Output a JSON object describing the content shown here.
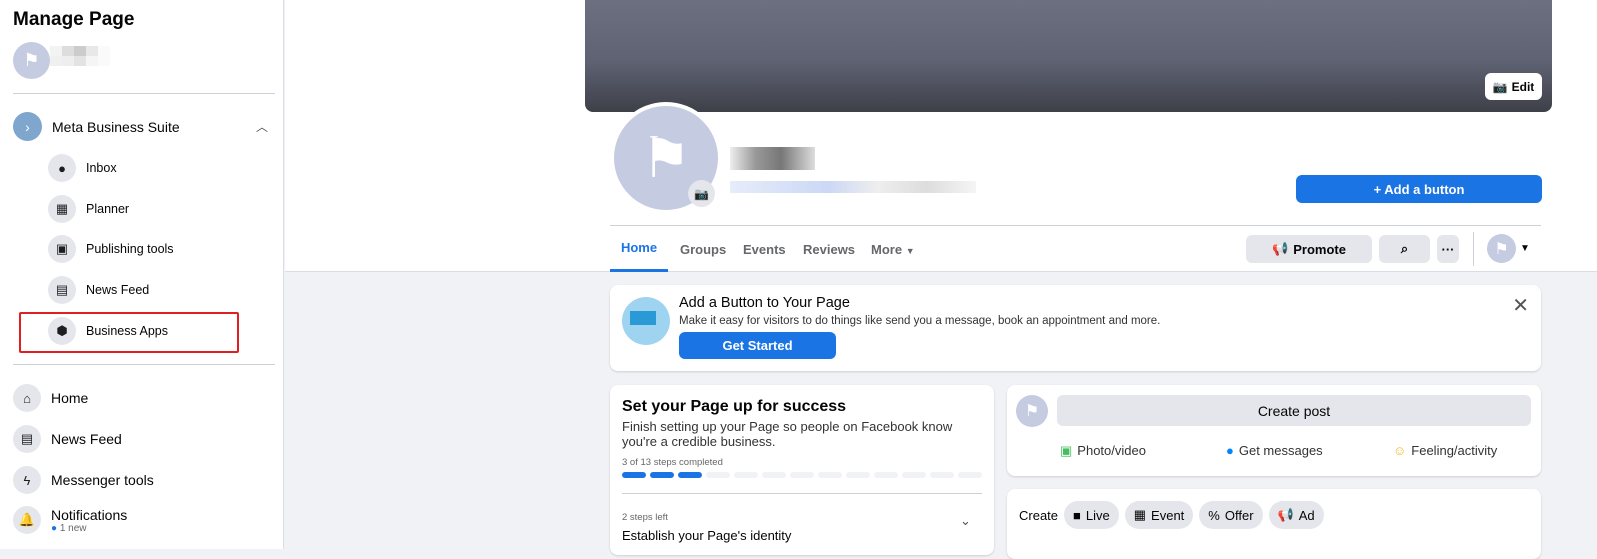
{
  "sidebar": {
    "title": "Manage Page",
    "suite": {
      "label": "Meta Business Suite",
      "items": [
        {
          "label": "Inbox",
          "icon": "chat-bubble-icon"
        },
        {
          "label": "Planner",
          "icon": "calendar-icon"
        },
        {
          "label": "Publishing tools",
          "icon": "publishing-icon"
        },
        {
          "label": "News Feed",
          "icon": "news-feed-icon"
        },
        {
          "label": "Business Apps",
          "icon": "cube-icon"
        }
      ]
    },
    "nav": [
      {
        "label": "Home",
        "icon": "home-icon"
      },
      {
        "label": "News Feed",
        "icon": "news-feed-icon"
      },
      {
        "label": "Messenger tools",
        "icon": "messenger-icon"
      },
      {
        "label": "Notifications",
        "icon": "bell-icon",
        "badge": "1 new"
      }
    ],
    "highlight_color": "#e02020"
  },
  "header": {
    "edit_label": "Edit",
    "add_button_label": "+ Add a button",
    "tabs": [
      "Home",
      "Groups",
      "Events",
      "Reviews",
      "More"
    ],
    "active_tab": "Home",
    "promote_label": "Promote"
  },
  "add_button_card": {
    "title": "Add a Button to Your Page",
    "text": "Make it easy for visitors to do things like send you a message, book an appointment and more.",
    "cta": "Get Started"
  },
  "setup_card": {
    "title": "Set your Page up for success",
    "text": "Finish setting up your Page so people on Facebook know you're a credible business.",
    "progress_label": "3 of 13 steps completed",
    "steps_done": 3,
    "steps_total": 13,
    "steps_left": "2 steps left",
    "section": "Establish your Page's identity"
  },
  "create_post": {
    "button": "Create post",
    "actions": [
      {
        "label": "Photo/video",
        "color": "#45bd62"
      },
      {
        "label": "Get messages",
        "color": "#0084ff"
      },
      {
        "label": "Feeling/activity",
        "color": "#f7b928"
      }
    ]
  },
  "create_bar": {
    "label": "Create",
    "chips": [
      "Live",
      "Event",
      "Offer",
      "Ad"
    ]
  },
  "colors": {
    "accent": "#1b74e4"
  }
}
